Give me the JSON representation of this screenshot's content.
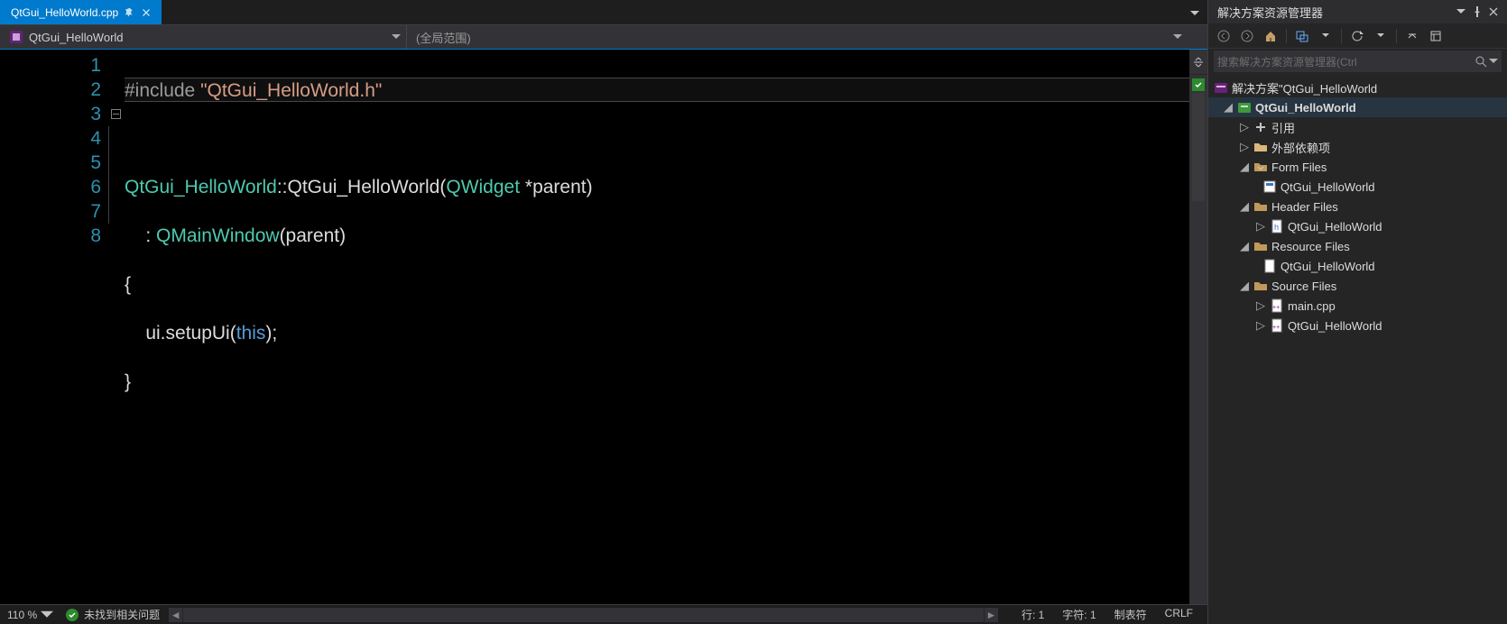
{
  "tab": {
    "filename": "QtGui_HelloWorld.cpp"
  },
  "nav": {
    "class": "QtGui_HelloWorld",
    "scope": "(全局范围)"
  },
  "code": {
    "lines": [
      "1",
      "2",
      "3",
      "4",
      "5",
      "6",
      "7",
      "8"
    ],
    "l1_include": "#include ",
    "l1_str": "\"QtGui_HelloWorld.h\"",
    "l3_a": "QtGui_HelloWorld",
    "l3_b": "::",
    "l3_c": "QtGui_HelloWorld",
    "l3_d": "(",
    "l3_e": "QWidget",
    "l3_f": " *parent)",
    "l4_a": "    : ",
    "l4_b": "QMainWindow",
    "l4_c": "(parent)",
    "l5": "{",
    "l6_a": "    ui.setupUi(",
    "l6_b": "this",
    "l6_c": ");",
    "l7": "}"
  },
  "status": {
    "zoom": "110 %",
    "issues": "未找到相关问题",
    "row": "行: 1",
    "col": "字符: 1",
    "tabs": "制表符",
    "ending": "CRLF"
  },
  "solution": {
    "panel_title": "解决方案资源管理器",
    "search_placeholder": "搜索解决方案资源管理器(Ctrl",
    "root": "解决方案\"QtGui_HelloWorld",
    "project": "QtGui_HelloWorld",
    "refs": "引用",
    "ext": "外部依赖项",
    "form_folder": "Form Files",
    "form_file": "QtGui_HelloWorld",
    "header_folder": "Header Files",
    "header_file": "QtGui_HelloWorld",
    "res_folder": "Resource Files",
    "res_file": "QtGui_HelloWorld",
    "src_folder": "Source Files",
    "src_main": "main.cpp",
    "src_file": "QtGui_HelloWorld"
  }
}
